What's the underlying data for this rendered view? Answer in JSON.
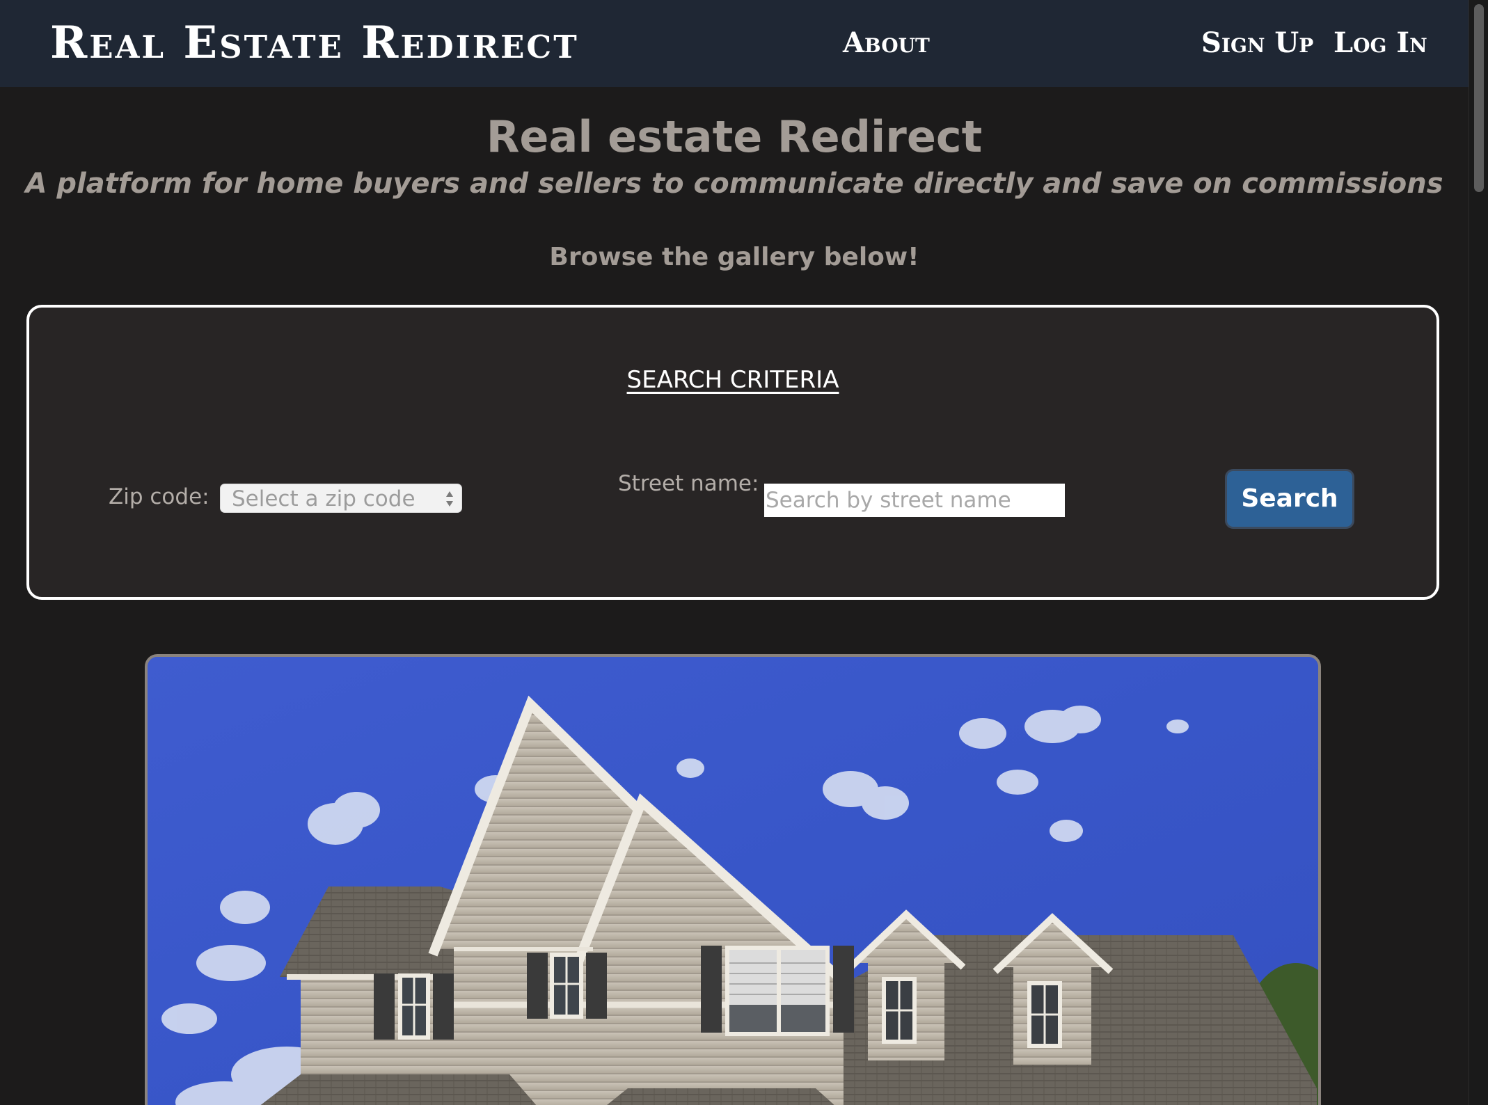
{
  "navbar": {
    "brand": "Real Estate Redirect",
    "about": "About",
    "sign_up": "Sign Up",
    "log_in": "Log In",
    "background": "#1f2734"
  },
  "hero": {
    "title": "Real estate Redirect",
    "subtitle": "A platform for home buyers and sellers to communicate directly and save on commissions",
    "browse": "Browse the gallery below!"
  },
  "search": {
    "heading": "SEARCH CRITERIA",
    "zip_label": "Zip code:",
    "zip_selected": "Select a zip code",
    "street_label": "Street name:",
    "street_placeholder": "Search by street name",
    "street_value": "",
    "button_label": "Search",
    "button_color": "#2d6196"
  },
  "gallery": {
    "items": [
      {
        "image_icon": "house-photo"
      }
    ]
  },
  "colors": {
    "page_background": "#1c1b1b",
    "panel_background": "#282525",
    "muted_text": "#a39c96"
  }
}
